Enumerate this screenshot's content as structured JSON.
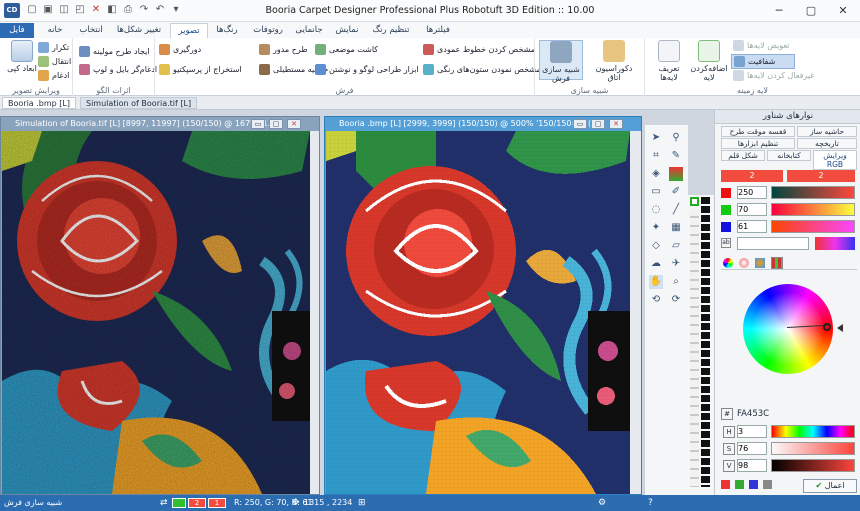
{
  "app": {
    "title": "Booria Carpet Designer Professional Plus Robotuft 3D Edition :: 10.00",
    "logo": "CD"
  },
  "tabs": [
    "فایل",
    "خانه",
    "انتخاب",
    "تغییر شکل‌ها",
    "تصویر",
    "رنگ‌ها",
    "روتوفات",
    "جانمایی",
    "نمایش",
    "تنظیم رنگ",
    "فیلترها"
  ],
  "ribbon": {
    "edit": {
      "label": "ویرایش تصویر",
      "big": "ابعاد کپی",
      "items": [
        "تکرار",
        "انتقال",
        "ادغام"
      ]
    },
    "pattern": {
      "label": "اثرات الگو",
      "items": [
        "ایجاد طرح مولینه",
        "ادغام‌گر بایل و لوپ"
      ]
    },
    "carpet": {
      "label": "فرش",
      "items": [
        "دورگیری",
        "طرح مدور",
        "حاشیه مستطیلی",
        "استخراج از پرسپکتیو",
        "کاشت موضعی",
        "ابزار طراحی لوگو و نوشتن",
        "مشخص کردن خطوط عمودی",
        "مشخص نمودن ستون‌های رنگی"
      ]
    },
    "sim": {
      "label": "شبیه سازی",
      "items": [
        "شبیه سازی فرش",
        "دکوراسیون اتاق"
      ]
    },
    "layer": {
      "label": "لایه زمینه",
      "items": [
        "تعریف لایه‌ها",
        "اضافه‌کردن لایه",
        "تعویض لایه‌ها",
        "شفافیت",
        "غیرفعال کردن لایه‌ها"
      ]
    }
  },
  "doctabs": [
    "Booria .bmp [L]",
    "Simulation of Booria.tif [L]"
  ],
  "windows": {
    "left": {
      "title": "Simulation of Booria.tif [L] [8997, 11997] (150/150)  @ 167% '1..."
    },
    "right": {
      "title": "Booria .bmp [L] [2999, 3999] (150/150)  @ 500% '150/150=1' (0..."
    }
  },
  "panel": {
    "title": "نوارهای شناور",
    "tabs": [
      "حاشیه ساز",
      "قفسه موقت طرح",
      "تاریخچه",
      "تنظیم ابزارها",
      "ویرایش RGB",
      "کتابخانه",
      "شکل قلم"
    ],
    "swatches": [
      "2",
      "2"
    ],
    "rgb": {
      "r": "250",
      "g": "70",
      "b": "61"
    },
    "labels": {
      "r": "R",
      "g": "G",
      "b": "B",
      "h": "H",
      "s": "S",
      "v": "V"
    },
    "hex": "FA453C",
    "hsv": {
      "h": "3",
      "s": "76",
      "v": "98"
    },
    "apply": "اعمال",
    "colors": {
      "fg": "#FA453C",
      "accent": "#2c6db1"
    }
  },
  "status": {
    "mode": "شبیه سازی فرش",
    "fg_label": "2",
    "bg_label": "1",
    "rgb": "R: 250, G: 70, B: 61",
    "coords": "1315 , 2234"
  },
  "icons": [
    "logo-icon",
    "save-icon",
    "undo-icon",
    "redo-icon",
    "print-icon",
    "minimize-icon",
    "maximize-icon",
    "close-icon",
    "pointer-icon",
    "eyedropper-icon",
    "bucket-icon",
    "brush-icon",
    "pencil-icon",
    "eraser-icon",
    "crop-icon",
    "hand-icon",
    "zoom-icon",
    "apply-check-icon"
  ]
}
